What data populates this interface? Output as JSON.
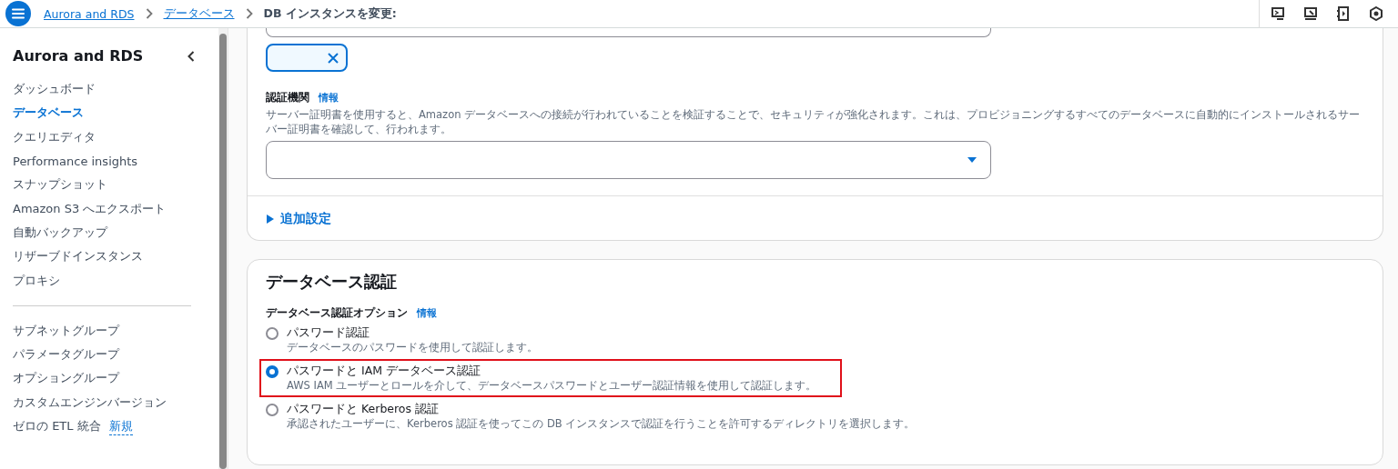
{
  "breadcrumbs": [
    {
      "label": "Aurora and RDS",
      "link": true
    },
    {
      "label": "データベース",
      "link": true
    },
    {
      "label": "DB インスタンスを変更:",
      "link": false
    }
  ],
  "sidebar": {
    "title": "Aurora and RDS",
    "items": [
      {
        "label": "ダッシュボード",
        "selected": false
      },
      {
        "label": "データベース",
        "selected": true
      },
      {
        "label": "クエリエディタ",
        "selected": false
      },
      {
        "label": "Performance insights",
        "selected": false
      },
      {
        "label": "スナップショット",
        "selected": false
      },
      {
        "label": "Amazon S3 へエクスポート",
        "selected": false
      },
      {
        "label": "自動バックアップ",
        "selected": false
      },
      {
        "label": "リザーブドインスタンス",
        "selected": false
      },
      {
        "label": "プロキシ",
        "selected": false
      }
    ],
    "items_2": [
      {
        "label": "サブネットグループ",
        "selected": false
      },
      {
        "label": "パラメータグループ",
        "selected": false
      },
      {
        "label": "オプショングループ",
        "selected": false
      },
      {
        "label": "カスタムエンジンバージョン",
        "selected": false
      },
      {
        "label": "ゼロの ETL 統合",
        "selected": false,
        "badge": "新規"
      }
    ]
  },
  "certificate": {
    "label": "認証機関",
    "info": "情報",
    "description": "サーバー証明書を使用すると、Amazon データベースへの接続が行われていることを検証することで、セキュリティが強化されます。これは、プロビジョニングするすべてのデータベースに自動的にインストールされるサーバー証明書を確認して、行われます。"
  },
  "additional_settings": {
    "label": "追加設定",
    "expanded": false
  },
  "auth": {
    "title": "データベース認証",
    "label": "データベース認証オプション",
    "info": "情報",
    "options": [
      {
        "label": "パスワード認証",
        "description": "データベースのパスワードを使用して認証します。",
        "selected": false,
        "highlighted": false
      },
      {
        "label": "パスワードと IAM データベース認証",
        "description": "AWS IAM ユーザーとロールを介して、データベースパスワードとユーザー認証情報を使用して認証します。",
        "selected": true,
        "highlighted": true
      },
      {
        "label": "パスワードと Kerberos 認証",
        "description": "承認されたユーザーに、Kerberos 認証を使ってこの DB インスタンスで認証を行うことを許可するディレクトリを選択します。",
        "selected": false,
        "highlighted": false
      }
    ]
  }
}
